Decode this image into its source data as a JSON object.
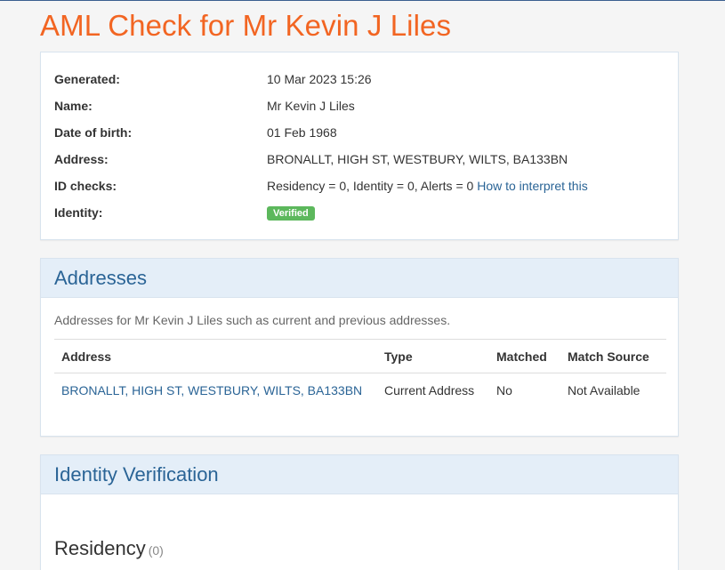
{
  "page": {
    "title": "AML Check for Mr Kevin J Liles"
  },
  "summary": {
    "generated_label": "Generated:",
    "generated_value": "10 Mar 2023 15:26",
    "name_label": "Name:",
    "name_value": "Mr Kevin J Liles",
    "dob_label": "Date of birth:",
    "dob_value": "01 Feb 1968",
    "address_label": "Address:",
    "address_value": "BRONALLT, HIGH ST, WESTBURY, WILTS, BA133BN",
    "id_checks_label": "ID checks:",
    "id_checks_value": "Residency = 0, Identity = 0, Alerts = 0",
    "id_checks_link": "How to interpret this",
    "identity_label": "Identity:",
    "identity_badge": "Verified"
  },
  "addresses": {
    "heading": "Addresses",
    "description": "Addresses for Mr Kevin J Liles such as current and previous addresses.",
    "columns": {
      "address": "Address",
      "type": "Type",
      "matched": "Matched",
      "match_source": "Match Source"
    },
    "rows": [
      {
        "address": "BRONALLT, HIGH ST, WESTBURY, WILTS, BA133BN",
        "type": "Current Address",
        "matched": "No",
        "match_source": "Not Available"
      }
    ]
  },
  "identity_verification": {
    "heading": "Identity Verification",
    "residency_title": "Residency",
    "residency_count": "(0)"
  },
  "colors": {
    "title_orange": "#f26522",
    "link_blue": "#2a6496",
    "panel_heading_bg": "#e4eef8",
    "badge_green": "#5cb85c"
  }
}
